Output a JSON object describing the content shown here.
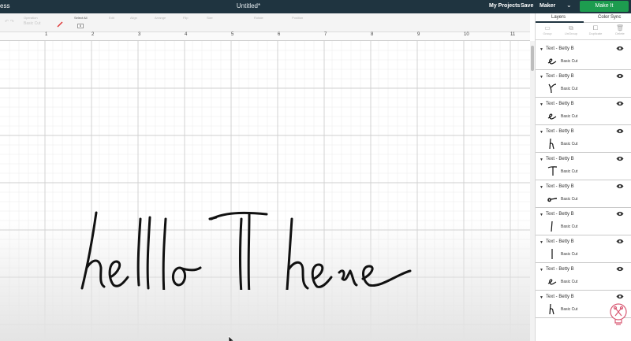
{
  "topbar": {
    "brand": "ess",
    "doc_title": "Untitled*",
    "my_projects": "My Projects",
    "save": "Save",
    "machine": "Maker",
    "make_it": "Make It",
    "accent": "#1d9c4f",
    "bg": "#1f3440"
  },
  "toolbar": {
    "groups": [
      {
        "label": "Operation",
        "value": "Basic Cut"
      },
      {
        "label": "Select All",
        "value": ""
      },
      {
        "label": "Edit",
        "value": ""
      },
      {
        "label": "Align",
        "value": ""
      },
      {
        "label": "Arrange",
        "value": ""
      },
      {
        "label": "Flip",
        "value": ""
      },
      {
        "label": "Size",
        "value": ""
      },
      {
        "label": "Rotate",
        "value": ""
      },
      {
        "label": "Position",
        "value": ""
      }
    ],
    "box_value": "6"
  },
  "ruler": {
    "numbers": [
      "1",
      "2",
      "3",
      "4",
      "5",
      "6",
      "7",
      "8",
      "9",
      "10",
      "11"
    ]
  },
  "canvas": {
    "text": "hello There"
  },
  "panel": {
    "tabs": [
      "Layers",
      "Color Sync"
    ],
    "actions": [
      {
        "icon": "group-icon",
        "label": "Group"
      },
      {
        "icon": "ungroup-icon",
        "label": "UnGroup"
      },
      {
        "icon": "duplicate-icon",
        "label": "Duplicate"
      },
      {
        "icon": "delete-icon",
        "label": "Delete"
      }
    ],
    "layers": [
      {
        "name": "Text - Betty B",
        "operation": "Basic Cut",
        "glyph": "e"
      },
      {
        "name": "Text - Betty B",
        "operation": "Basic Cut",
        "glyph": "r"
      },
      {
        "name": "Text - Betty B",
        "operation": "Basic Cut",
        "glyph": "e"
      },
      {
        "name": "Text - Betty B",
        "operation": "Basic Cut",
        "glyph": "h"
      },
      {
        "name": "Text - Betty B",
        "operation": "Basic Cut",
        "glyph": "T"
      },
      {
        "name": "Text - Betty B",
        "operation": "Basic Cut",
        "glyph": "o"
      },
      {
        "name": "Text - Betty B",
        "operation": "Basic Cut",
        "glyph": "l"
      },
      {
        "name": "Text - Betty B",
        "operation": "Basic Cut",
        "glyph": "l"
      },
      {
        "name": "Text - Betty B",
        "operation": "Basic Cut",
        "glyph": "e"
      },
      {
        "name": "Text - Betty B",
        "operation": "Basic Cut",
        "glyph": "h"
      }
    ]
  }
}
